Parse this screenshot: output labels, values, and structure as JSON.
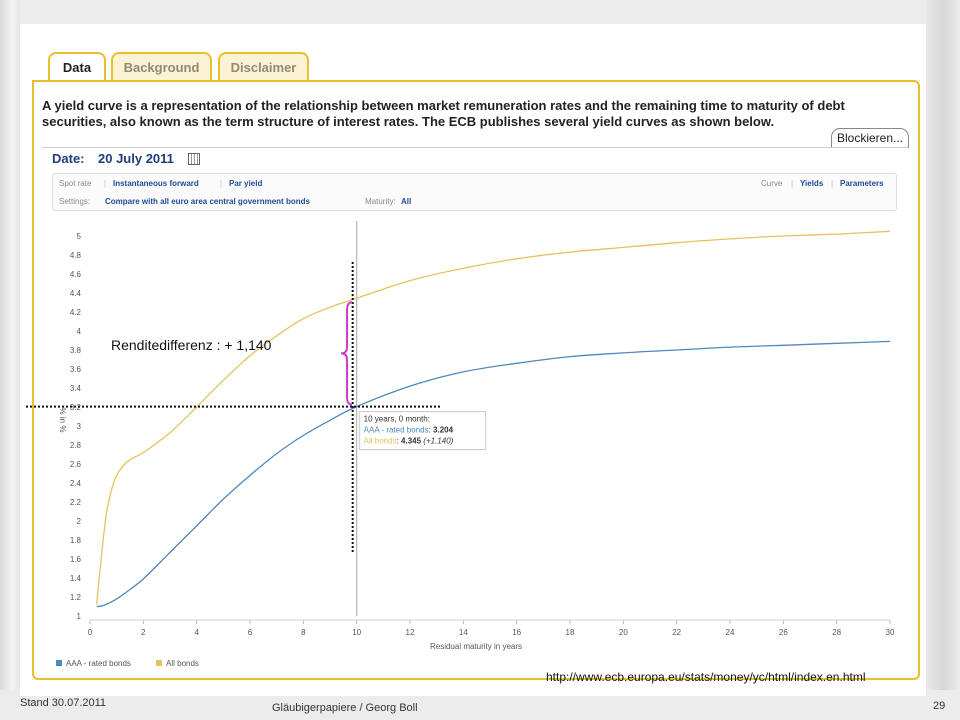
{
  "tabs": [
    {
      "label": "Data",
      "active": true
    },
    {
      "label": "Background",
      "active": false
    },
    {
      "label": "Disclaimer",
      "active": false
    }
  ],
  "intro_text": "A yield curve is a representation of the relationship between market remuneration rates and the remaining time to maturity of debt securities, also known as the term structure of interest rates. The ECB publishes several yield curves as shown below.",
  "blockieren_label": "Blockieren...",
  "date": {
    "label": "Date:",
    "value": "20 July 2011"
  },
  "controls": {
    "row1_left": [
      "Spot rate",
      "Instantaneous forward",
      "Par yield"
    ],
    "row1_right": [
      "Curve",
      "Yields",
      "Parameters"
    ],
    "settings_label": "Settings:",
    "settings_value": "Compare with all euro area central government bonds",
    "maturity_label": "Maturity:",
    "maturity_value": "All"
  },
  "colors": {
    "aaa": "#4f87bf",
    "all": "#e6c15c",
    "accent": "#e8c02a",
    "brace": "#cc3fc4"
  },
  "chart_data": {
    "type": "line",
    "xlabel": "Residual maturity in years",
    "ylabel": "% in %",
    "xlim": [
      0,
      30
    ],
    "ylim": [
      1,
      5.1
    ],
    "x_ticks": [
      "0",
      "2",
      "4",
      "6",
      "8",
      "10",
      "12",
      "14",
      "16",
      "18",
      "20",
      "22",
      "24",
      "26",
      "28",
      "30"
    ],
    "y_ticks": [
      "1",
      "1.2",
      "1.4",
      "1.6",
      "1.8",
      "2",
      "2.2",
      "2.4",
      "2.6",
      "2.8",
      "3",
      "3.2",
      "3.4",
      "3.6",
      "3.8",
      "4",
      "4.2",
      "4.4",
      "4.6",
      "4.8",
      "5"
    ],
    "series": [
      {
        "name": "AAA - rated bonds",
        "x": [
          0.25,
          0.5,
          1,
          1.5,
          2,
          3,
          4,
          5,
          6,
          7,
          8,
          9,
          10,
          12,
          14,
          16,
          18,
          20,
          22,
          24,
          26,
          28,
          30
        ],
        "y": [
          1.1,
          1.11,
          1.18,
          1.28,
          1.39,
          1.67,
          1.95,
          2.23,
          2.48,
          2.71,
          2.9,
          3.06,
          3.204,
          3.42,
          3.57,
          3.66,
          3.73,
          3.77,
          3.8,
          3.83,
          3.85,
          3.87,
          3.89
        ]
      },
      {
        "name": "All bonds",
        "x": [
          0.25,
          0.4,
          0.6,
          0.8,
          1,
          1.3,
          1.6,
          2,
          2.5,
          3,
          3.5,
          4,
          5,
          6,
          7,
          8,
          9,
          10,
          12,
          14,
          16,
          18,
          20,
          22,
          24,
          26,
          28,
          30
        ],
        "y": [
          1.12,
          1.55,
          2.05,
          2.32,
          2.48,
          2.6,
          2.66,
          2.72,
          2.82,
          2.93,
          3.06,
          3.2,
          3.48,
          3.74,
          3.95,
          4.13,
          4.25,
          4.345,
          4.53,
          4.66,
          4.76,
          4.83,
          4.88,
          4.93,
          4.97,
          5.0,
          5.02,
          5.05
        ]
      }
    ],
    "cursor_x": 10,
    "tooltip": {
      "title": "10 years, 0 month:",
      "line1_label": "AAA - rated bonds",
      "line1_value": "3.204",
      "line2_label": "All bonds",
      "line2_value": "4.345",
      "line2_diff": "(+1.140)"
    },
    "annotation": "Renditedifferenz : + 1,140",
    "legend": [
      "AAA - rated bonds",
      "All bonds"
    ]
  },
  "source_url": "http://www.ecb.europa.eu/stats/money/yc/html/index.en.html",
  "footer": {
    "left": "Stand 30.07.2011",
    "center": "Gläubigerpapiere / Georg Boll",
    "page": "29"
  }
}
